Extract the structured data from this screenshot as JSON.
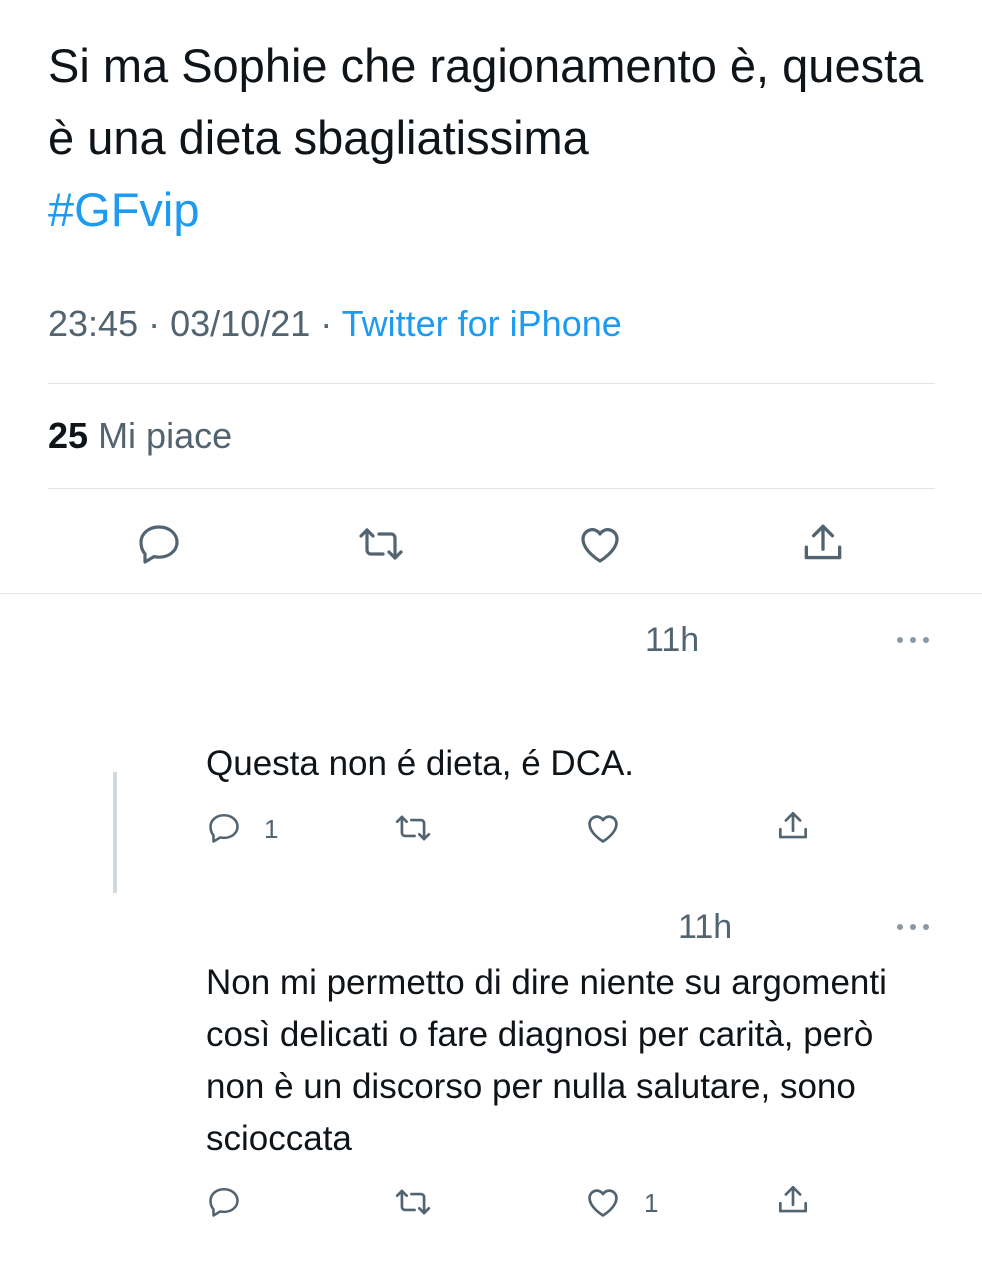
{
  "tweet": {
    "text": "Si ma Sophie che ragionamento è, questa è una dieta sbagliatissima",
    "hashtag": "#GFvip",
    "time": "23:45",
    "separator": "·",
    "date": "03/10/21",
    "source": "Twitter for iPhone",
    "likes_count": "25",
    "likes_label": "Mi piace",
    "actions": [
      "reply-icon",
      "retweet-icon",
      "like-icon",
      "share-icon"
    ]
  },
  "replies": [
    {
      "time": "11h",
      "text": "Questa non é dieta, é DCA.",
      "reply_count": "1",
      "like_count": ""
    },
    {
      "time": "11h",
      "text": "Non mi permetto di dire niente su argomenti così delicati o fare diagnosi per carità, però non è un discorso per nulla salutare, sono scioccata",
      "reply_count": "",
      "like_count": "1"
    }
  ],
  "colors": {
    "text": "#0f1419",
    "secondary": "#536471",
    "link": "#1d9bf0",
    "divider": "#e1e6ea"
  }
}
